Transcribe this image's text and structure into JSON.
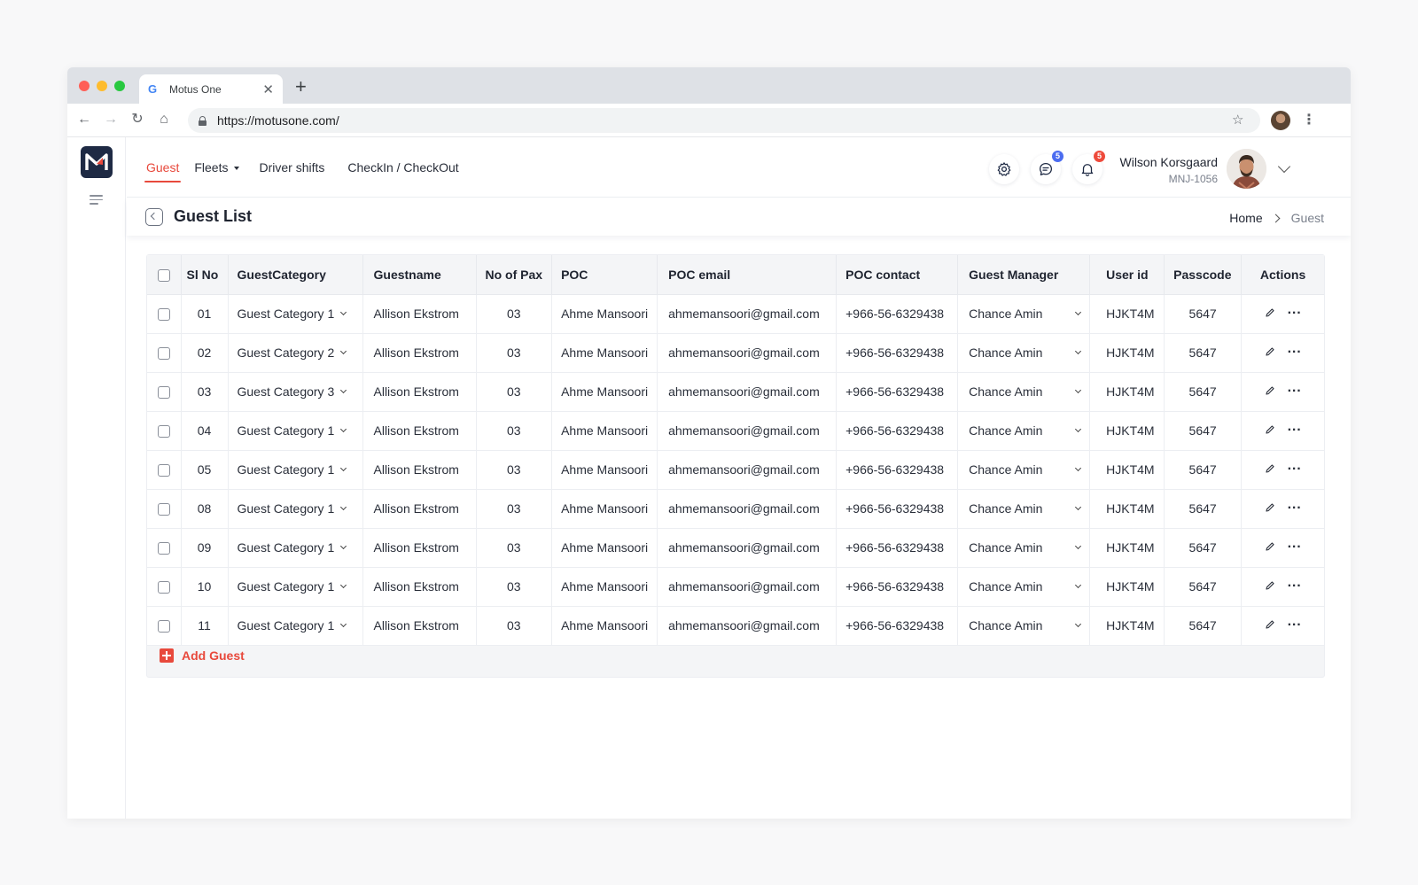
{
  "browser": {
    "tab_title": "Motus One",
    "url": "https://motusone.com/"
  },
  "topnav": {
    "links": [
      "Guest",
      "Fleets",
      "Driver shifts",
      "CheckIn / CheckOut"
    ],
    "messages_count": "5",
    "notifications_count": "5",
    "user_name": "Wilson Korsgaard",
    "user_id": "MNJ-1056"
  },
  "page": {
    "title": "Guest List",
    "breadcrumb_home": "Home",
    "breadcrumb_current": "Guest"
  },
  "table": {
    "headers": [
      "Sl No",
      "GuestCategory",
      "Guestname",
      "No of Pax",
      "POC",
      "POC email",
      "POC contact",
      "Guest Manager",
      "User id",
      "Passcode",
      "Actions"
    ],
    "rows": [
      {
        "sl": "01",
        "category": "Guest Category 1",
        "name": "Allison Ekstrom",
        "pax": "03",
        "poc": "Ahme Mansoori",
        "email": "ahmemansoori@gmail.com",
        "contact": "+966-56-6329438",
        "manager": "Chance Amin",
        "userid": "HJKT4M",
        "passcode": "5647"
      },
      {
        "sl": "02",
        "category": "Guest Category 2",
        "name": "Allison Ekstrom",
        "pax": "03",
        "poc": "Ahme Mansoori",
        "email": "ahmemansoori@gmail.com",
        "contact": "+966-56-6329438",
        "manager": "Chance Amin",
        "userid": "HJKT4M",
        "passcode": "5647"
      },
      {
        "sl": "03",
        "category": "Guest Category 3",
        "name": "Allison Ekstrom",
        "pax": "03",
        "poc": "Ahme Mansoori",
        "email": "ahmemansoori@gmail.com",
        "contact": "+966-56-6329438",
        "manager": "Chance Amin",
        "userid": "HJKT4M",
        "passcode": "5647"
      },
      {
        "sl": "04",
        "category": "Guest Category 1",
        "name": "Allison Ekstrom",
        "pax": "03",
        "poc": "Ahme Mansoori",
        "email": "ahmemansoori@gmail.com",
        "contact": "+966-56-6329438",
        "manager": "Chance Amin",
        "userid": "HJKT4M",
        "passcode": "5647"
      },
      {
        "sl": "05",
        "category": "Guest Category 1",
        "name": "Allison Ekstrom",
        "pax": "03",
        "poc": "Ahme Mansoori",
        "email": "ahmemansoori@gmail.com",
        "contact": "+966-56-6329438",
        "manager": "Chance Amin",
        "userid": "HJKT4M",
        "passcode": "5647"
      },
      {
        "sl": "08",
        "category": "Guest Category 1",
        "name": "Allison Ekstrom",
        "pax": "03",
        "poc": "Ahme Mansoori",
        "email": "ahmemansoori@gmail.com",
        "contact": "+966-56-6329438",
        "manager": "Chance Amin",
        "userid": "HJKT4M",
        "passcode": "5647"
      },
      {
        "sl": "09",
        "category": "Guest Category 1",
        "name": "Allison Ekstrom",
        "pax": "03",
        "poc": "Ahme Mansoori",
        "email": "ahmemansoori@gmail.com",
        "contact": "+966-56-6329438",
        "manager": "Chance Amin",
        "userid": "HJKT4M",
        "passcode": "5647"
      },
      {
        "sl": "10",
        "category": "Guest Category 1",
        "name": "Allison Ekstrom",
        "pax": "03",
        "poc": "Ahme Mansoori",
        "email": "ahmemansoori@gmail.com",
        "contact": "+966-56-6329438",
        "manager": "Chance Amin",
        "userid": "HJKT4M",
        "passcode": "5647"
      },
      {
        "sl": "11",
        "category": "Guest Category 1",
        "name": "Allison Ekstrom",
        "pax": "03",
        "poc": "Ahme Mansoori",
        "email": "ahmemansoori@gmail.com",
        "contact": "+966-56-6329438",
        "manager": "Chance Amin",
        "userid": "HJKT4M",
        "passcode": "5647"
      }
    ],
    "add_label": "Add Guest"
  },
  "colors": {
    "accent": "#e8493c",
    "badge_blue": "#4b6cf0",
    "badge_red": "#ee4a3b",
    "logo_bg": "#1e2a44"
  }
}
